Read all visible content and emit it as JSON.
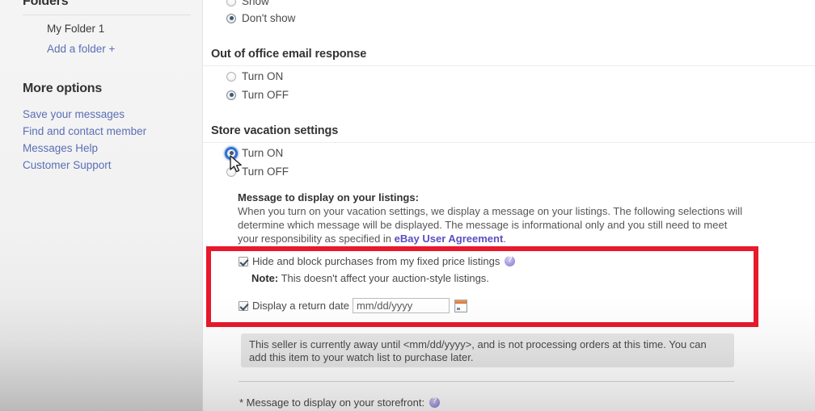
{
  "sidebar": {
    "folders_heading": "Folders",
    "folders": [
      {
        "label": "My Folder 1",
        "type": "text"
      },
      {
        "label": "Add a folder +",
        "type": "link"
      }
    ],
    "more_options_heading": "More options",
    "more_options": [
      {
        "label": "Save your messages"
      },
      {
        "label": "Find and contact member"
      },
      {
        "label": "Messages Help"
      },
      {
        "label": "Customer Support"
      }
    ]
  },
  "main": {
    "show_section": {
      "options": [
        {
          "label": "Show",
          "selected": false
        },
        {
          "label": "Don't show",
          "selected": true
        }
      ]
    },
    "out_of_office": {
      "heading": "Out of office email response",
      "options": [
        {
          "label": "Turn ON",
          "selected": false
        },
        {
          "label": "Turn OFF",
          "selected": true
        }
      ]
    },
    "vacation": {
      "heading": "Store vacation settings",
      "options": [
        {
          "label": "Turn ON",
          "selected": true,
          "focused": true
        },
        {
          "label": "Turn OFF",
          "selected": false
        }
      ],
      "message_title": "Message to display on your listings:",
      "message_body_part1": "When you turn on your vacation settings, we display a message on your listings. The following selections will determine which message will be displayed. The message is informational only and you still need to meet your responsibility as specified in ",
      "message_link": "eBay User Agreement",
      "message_body_part2": "."
    },
    "highlighted": {
      "hide_block_checkbox": {
        "label": "Hide and block purchases from my fixed price listings",
        "checked": true
      },
      "note_bold": "Note:",
      "note_text": " This doesn't affect your auction-style listings.",
      "return_date_checkbox": {
        "label": "Display a return date",
        "checked": true
      },
      "return_date_value": "mm/dd/yyyy",
      "return_date_placeholder": "mm/dd/yyyy"
    },
    "notice_text": "This seller is currently away until <mm/dd/yyyy>, and is not processing orders at this time. You can add this item to your watch list to purchase later.",
    "storefront_label": "* Message to display on your storefront:"
  },
  "annotation": {
    "highlight_color": "#e8192c"
  },
  "icons": {
    "info": "info-icon",
    "calendar": "calendar-icon",
    "cursor": "mouse-cursor-arrow"
  }
}
